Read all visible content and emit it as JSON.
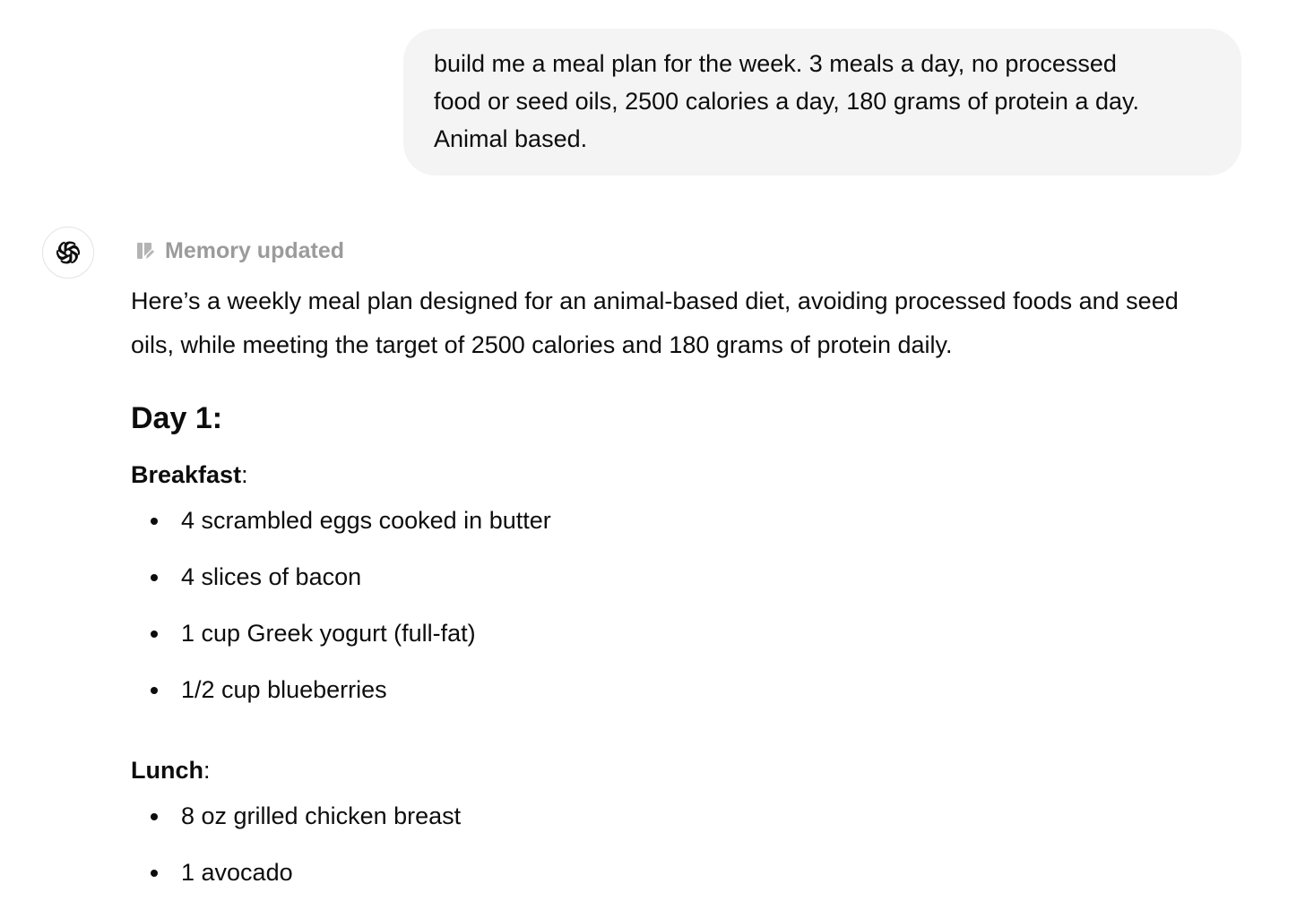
{
  "user_message": {
    "lines": [
      "build me a meal plan for the week.  3 meals a day, no processed",
      "food or seed oils, 2500 calories a day, 180 grams of protein a day.",
      "Animal based."
    ]
  },
  "assistant": {
    "avatar_icon": "openai-logo-icon",
    "memory_icon": "memory-edit-icon",
    "memory_label": "Memory updated",
    "intro_lines": [
      "Here’s a weekly meal plan designed for an animal-based diet, avoiding processed foods and seed",
      "oils, while meeting the target of 2500 calories and 180 grams of protein daily."
    ],
    "day_heading": "Day 1:",
    "meals": [
      {
        "name": "Breakfast",
        "suffix": ":",
        "items": [
          "4 scrambled eggs cooked in butter",
          "4 slices of bacon",
          "1 cup Greek yogurt (full-fat)",
          "1/2 cup blueberries"
        ]
      },
      {
        "name": "Lunch",
        "suffix": ":",
        "items": [
          "8 oz grilled chicken breast",
          "1 avocado"
        ]
      }
    ]
  }
}
